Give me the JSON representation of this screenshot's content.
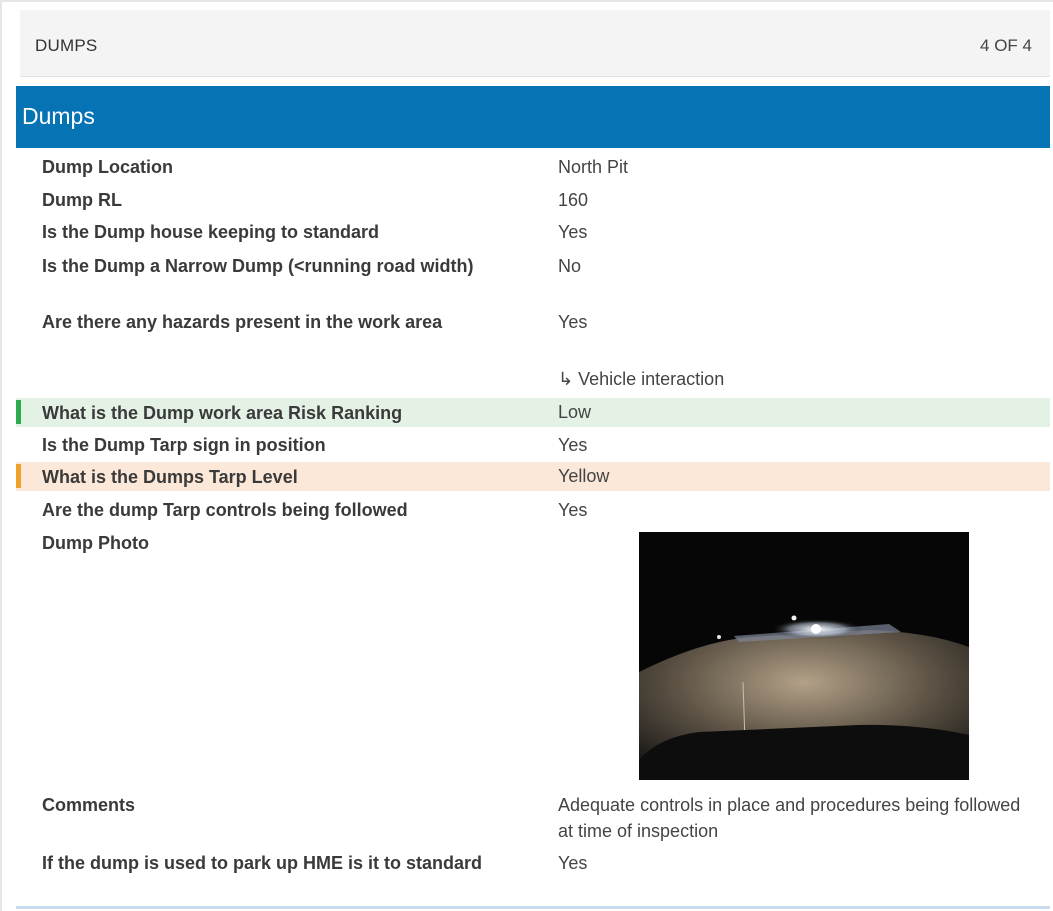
{
  "topbar": {
    "title": "DUMPS",
    "count": "4 OF 4"
  },
  "section": {
    "title": "Dumps"
  },
  "fields": [
    {
      "question": "Dump Location",
      "answer": "North Pit"
    },
    {
      "question": "Dump RL",
      "answer": "160"
    },
    {
      "question": "Is the Dump house keeping to standard",
      "answer": "Yes"
    },
    {
      "question": "Is the Dump a Narrow Dump (<running road width)",
      "answer": "No"
    },
    {
      "question": "Are there any hazards present in the work area",
      "answer": "Yes"
    },
    {
      "question": "What is the Dump work area Risk Ranking",
      "answer": "Low"
    },
    {
      "question": "Is the Dump Tarp sign in position",
      "answer": "Yes"
    },
    {
      "question": "What is the Dumps Tarp Level",
      "answer": "Yellow"
    },
    {
      "question": "Are the dump Tarp controls being followed",
      "answer": "Yes"
    },
    {
      "question": "Dump Photo",
      "answer": ""
    },
    {
      "question": "Comments",
      "answer": "Adequate controls in place and procedures being followed at time of inspection"
    },
    {
      "question": "If the dump is used to park up HME is it to standard",
      "answer": "Yes"
    }
  ],
  "hazard_sub": {
    "arrow": "↳",
    "text": "Vehicle interaction"
  },
  "colors": {
    "header_blue": "#0673b4",
    "risk_low": "#2eaa4f",
    "tarp_yellow": "#f0a12a"
  }
}
